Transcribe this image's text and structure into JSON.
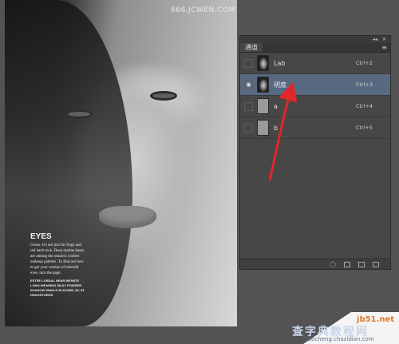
{
  "photo": {
    "watermark": "666.JCWEN.COM",
    "article": {
      "title": "EYES",
      "body": "Gesso: It's not just for frogs and red hard-rock. Deep marine bases are among the season's coolest makeup palettes. To find out how to get your version of emerald eyes, turn the page.",
      "caps": "ESTEE LORDAL NEAR INFINITE LONG-WEARING SILKY POWDER SHADOW SINGLE IN AZURE, $4. AT DRUGSTORES."
    }
  },
  "panel": {
    "tab": "通道",
    "menu_icon": "panel-menu-icon",
    "channels": [
      {
        "name": "Lab",
        "shortcut": "Ctrl+2",
        "visible": false,
        "selected": false,
        "thumb": "image"
      },
      {
        "name": "明度",
        "shortcut": "Ctrl+3",
        "visible": true,
        "selected": true,
        "thumb": "image"
      },
      {
        "name": "a",
        "shortcut": "Ctrl+4",
        "visible": false,
        "selected": false,
        "thumb": "flat"
      },
      {
        "name": "b",
        "shortcut": "Ctrl+5",
        "visible": false,
        "selected": false,
        "thumb": "flat"
      }
    ],
    "footer_icons": [
      "load-channel-as-selection-icon",
      "save-selection-icon",
      "new-channel-icon",
      "delete-channel-icon"
    ]
  },
  "annotation": {
    "color": "#e0262a"
  },
  "brand": {
    "site": "jb51.net",
    "big": "查字典教程网",
    "sub": "jiaocheng.chazidian.com"
  }
}
